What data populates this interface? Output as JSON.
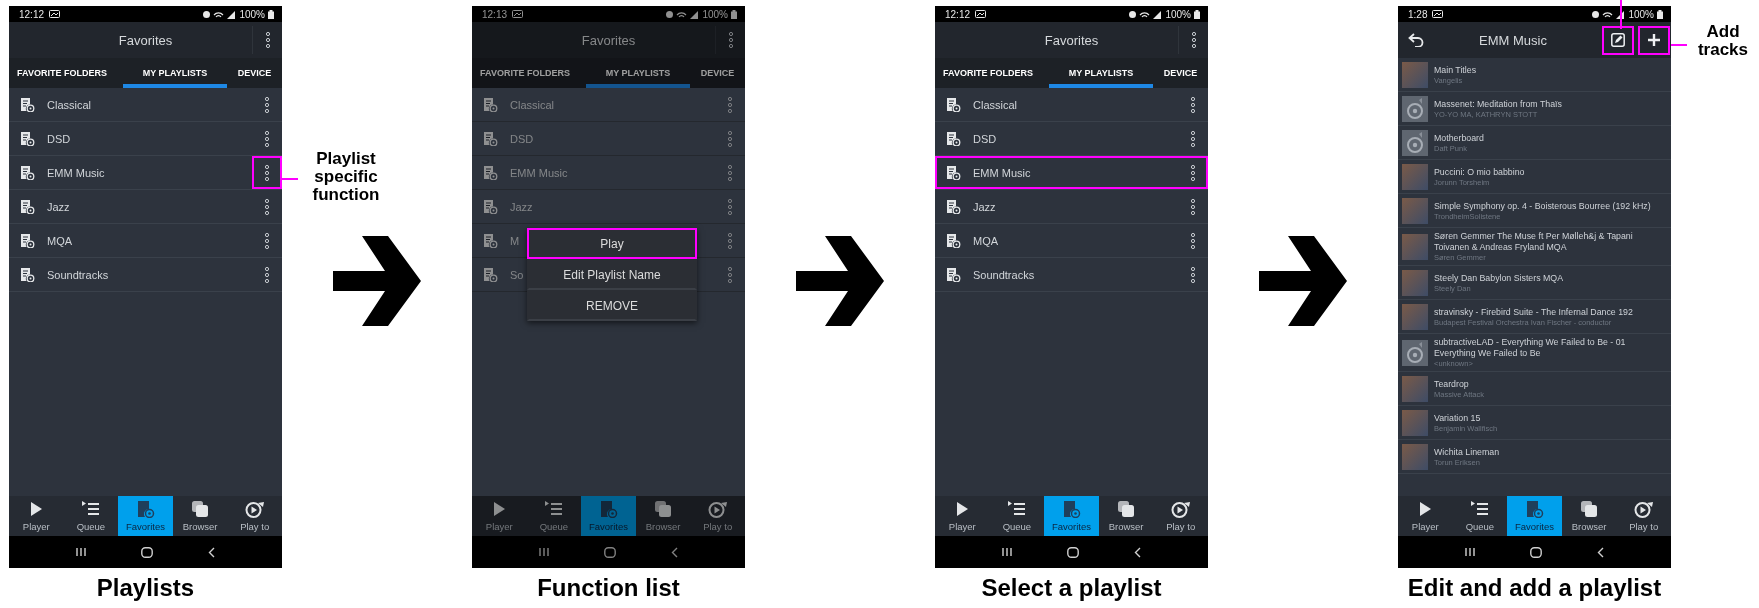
{
  "panels": [
    {
      "kind": "playlists",
      "dimmed": false,
      "status_time": "12:12",
      "status_battery": "100%",
      "title": "Favorites",
      "tabs": [
        {
          "label": "FAVORITE FOLDERS",
          "selected": false
        },
        {
          "label": "MY PLAYLISTS",
          "selected": true
        },
        {
          "label": "DEVICE",
          "selected": false
        }
      ],
      "playlists": [
        {
          "name": "Classical",
          "highlighted": false,
          "menu_highlighted": false
        },
        {
          "name": "DSD",
          "highlighted": false,
          "menu_highlighted": false
        },
        {
          "name": "EMM Music",
          "highlighted": false,
          "menu_highlighted": true
        },
        {
          "name": "Jazz",
          "highlighted": false,
          "menu_highlighted": false
        },
        {
          "name": "MQA",
          "highlighted": false,
          "menu_highlighted": false
        },
        {
          "name": "Soundtracks",
          "highlighted": false,
          "menu_highlighted": false
        }
      ],
      "callout": "Playlist specific function",
      "nav": [
        {
          "label": "Player",
          "selected": false
        },
        {
          "label": "Queue",
          "selected": false
        },
        {
          "label": "Favorites",
          "selected": true
        },
        {
          "label": "Browser",
          "selected": false
        },
        {
          "label": "Play to",
          "selected": false
        }
      ],
      "caption": "Playlists"
    },
    {
      "kind": "playlists",
      "dimmed": true,
      "status_time": "12:13",
      "status_battery": "100%",
      "title": "Favorites",
      "tabs": [
        {
          "label": "FAVORITE FOLDERS",
          "selected": false
        },
        {
          "label": "MY PLAYLISTS",
          "selected": true
        },
        {
          "label": "DEVICE",
          "selected": false
        }
      ],
      "playlists": [
        {
          "name": "Classical",
          "highlighted": false,
          "menu_highlighted": false
        },
        {
          "name": "DSD",
          "highlighted": false,
          "menu_highlighted": false
        },
        {
          "name": "EMM Music",
          "highlighted": false,
          "menu_highlighted": false
        },
        {
          "name": "Jazz",
          "highlighted": false,
          "menu_highlighted": false
        },
        {
          "name": "M",
          "highlighted": false,
          "menu_highlighted": false
        },
        {
          "name": "So",
          "highlighted": false,
          "menu_highlighted": false
        }
      ],
      "menu": [
        {
          "label": "Play",
          "highlighted": true
        },
        {
          "label": "Edit Playlist Name",
          "highlighted": false
        },
        {
          "label": "REMOVE",
          "highlighted": false
        }
      ],
      "nav": [
        {
          "label": "Player",
          "selected": false
        },
        {
          "label": "Queue",
          "selected": false
        },
        {
          "label": "Favorites",
          "selected": true
        },
        {
          "label": "Browser",
          "selected": false
        },
        {
          "label": "Play to",
          "selected": false
        }
      ],
      "caption": "Function list"
    },
    {
      "kind": "playlists",
      "dimmed": false,
      "status_time": "12:12",
      "status_battery": "100%",
      "title": "Favorites",
      "tabs": [
        {
          "label": "FAVORITE FOLDERS",
          "selected": false
        },
        {
          "label": "MY PLAYLISTS",
          "selected": true
        },
        {
          "label": "DEVICE",
          "selected": false
        }
      ],
      "playlists": [
        {
          "name": "Classical",
          "highlighted": false,
          "menu_highlighted": false
        },
        {
          "name": "DSD",
          "highlighted": false,
          "menu_highlighted": false
        },
        {
          "name": "EMM Music",
          "highlighted": true,
          "menu_highlighted": false
        },
        {
          "name": "Jazz",
          "highlighted": false,
          "menu_highlighted": false
        },
        {
          "name": "MQA",
          "highlighted": false,
          "menu_highlighted": false
        },
        {
          "name": "Soundtracks",
          "highlighted": false,
          "menu_highlighted": false
        }
      ],
      "nav": [
        {
          "label": "Player",
          "selected": false
        },
        {
          "label": "Queue",
          "selected": false
        },
        {
          "label": "Favorites",
          "selected": true
        },
        {
          "label": "Browser",
          "selected": false
        },
        {
          "label": "Play to",
          "selected": false
        }
      ],
      "caption": "Select a playlist"
    },
    {
      "kind": "playlist_detail",
      "status_time": "1:28",
      "status_battery": "100%",
      "title": "EMM Music",
      "actions": [
        {
          "kind": "edit",
          "highlighted": true
        },
        {
          "kind": "add",
          "highlighted": true,
          "callout": "Add tracks"
        }
      ],
      "tracks": [
        {
          "title": "Main Titles",
          "artist": "Vangelis",
          "kind": "cover"
        },
        {
          "title": "Massenet: Meditation from Thaïs",
          "artist": "YO-YO MA, KATHRYN STOTT",
          "kind": "disc"
        },
        {
          "title": "Motherboard",
          "artist": "Daft Punk",
          "kind": "disc"
        },
        {
          "title": "Puccini: O mio babbino",
          "artist": "Jorunn Torsheim",
          "kind": "cover"
        },
        {
          "title": "Simple Symphony  op. 4 - Boisterous Bourree (192 kHz)",
          "artist": "TrondheimSolistene",
          "kind": "cover"
        },
        {
          "title": "Søren Gemmer The Muse ft Per Mølleh&j & Tapani Toivanen & Andreas Fryland MQA",
          "artist": "Søren Gemmer",
          "kind": "cover"
        },
        {
          "title": "Steely Dan Babylon Sisters MQA",
          "artist": "Steely Dan",
          "kind": "cover"
        },
        {
          "title": "stravinsky - Firebird Suite - The Infernal Dance 192",
          "artist": "Budapest Festival Orchestra Ivan Fischer - conductor",
          "kind": "cover"
        },
        {
          "title": "subtractiveLAD - Everything We Failed to Be - 01 Everything We Failed to Be",
          "artist": "<unknown>",
          "kind": "disc"
        },
        {
          "title": "Teardrop",
          "artist": "Massive Attack",
          "kind": "cover"
        },
        {
          "title": "Variation 15",
          "artist": "Benjamin Wallfisch",
          "kind": "cover"
        },
        {
          "title": "Wichita Lineman",
          "artist": "Torun Eriksen",
          "kind": "cover"
        }
      ],
      "nav": [
        {
          "label": "Player",
          "selected": false
        },
        {
          "label": "Queue",
          "selected": false
        },
        {
          "label": "Favorites",
          "selected": true
        },
        {
          "label": "Browser",
          "selected": false
        },
        {
          "label": "Play to",
          "selected": false
        }
      ],
      "caption": "Edit and add a playlist"
    }
  ]
}
